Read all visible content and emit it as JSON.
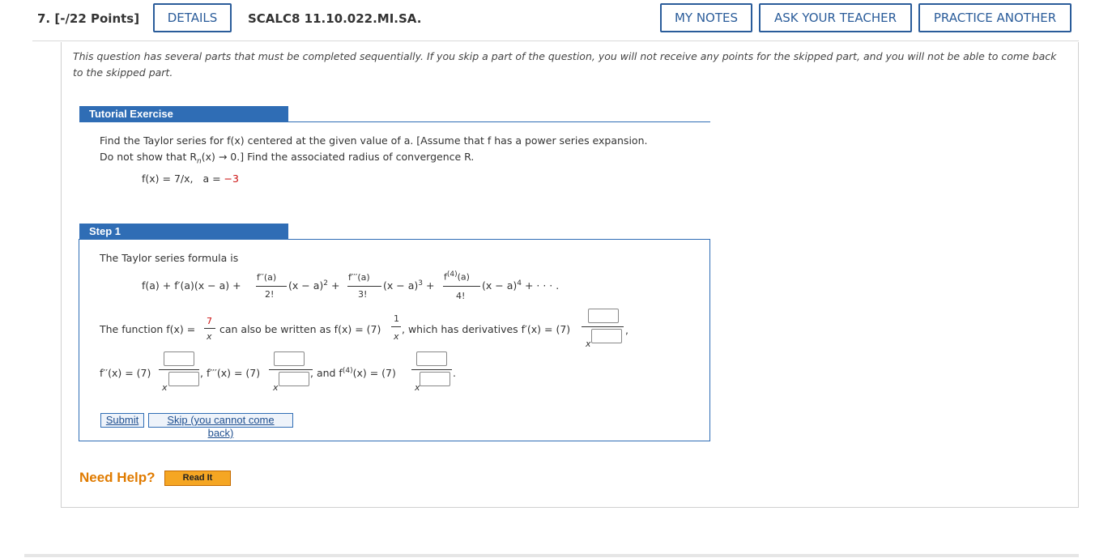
{
  "header": {
    "question_number": "7. [-/22 Points]",
    "details_label": "DETAILS",
    "question_code": "SCALC8 11.10.022.MI.SA.",
    "my_notes_label": "MY NOTES",
    "ask_teacher_label": "ASK YOUR TEACHER",
    "practice_another_label": "PRACTICE ANOTHER"
  },
  "intro_text": "This question has several parts that must be completed sequentially. If you skip a part of the question, you will not receive any points for the skipped part, and you will not be able to come back to the skipped part.",
  "tutorial": {
    "heading": "Tutorial Exercise",
    "problem_line1": "Find the Taylor series for f(x) centered at the given value of a. [Assume that f has a power series expansion.",
    "problem_line2_a": "Do not show that R",
    "problem_line2_sub": "n",
    "problem_line2_b": "(x) → 0.] Find the associated radius of convergence R.",
    "function": "f(x) = 7/x,",
    "a_label": "a = ",
    "a_value": "−3"
  },
  "step1": {
    "heading": "Step 1",
    "formula_intro": "The Taylor series formula is",
    "formula_lead": "f(a) + f′(a)(x − a) +",
    "term2_num": "f′′(a)",
    "term2_den": "2!",
    "term2_tail": "(x − a)",
    "term2_exp": "2",
    "plus1": "+",
    "term3_num": "f′′′(a)",
    "term3_den": "3!",
    "term3_tail": "(x − a)",
    "term3_exp": "3",
    "plus2": "+",
    "term4_num_a": "f",
    "term4_num_sup": "(4)",
    "term4_num_b": "(a)",
    "term4_den": "4!",
    "term4_tail": "(x − a)",
    "term4_exp": "4",
    "formula_end": "+ · · · .",
    "line2_a": "The function f(x) =",
    "frac_num": "7",
    "frac_den": "x",
    "line2_b": "can also be written as f(x) = (7)",
    "one": "1",
    "x_den": "x",
    "line2_c": ", which has derivatives f′(x) = (7)",
    "comma": ",",
    "f2_label": "f′′(x) = (7)",
    "f3_label": ", f′′′(x) = (7)",
    "f4_label_a": ", and f",
    "f4_label_sup": "(4)",
    "f4_label_b": "(x) = (7)",
    "period": ".",
    "submit_label": "Submit",
    "skip_label": "Skip (you cannot come back)"
  },
  "help": {
    "need_help": "Need Help?",
    "read_it": "Read It"
  }
}
